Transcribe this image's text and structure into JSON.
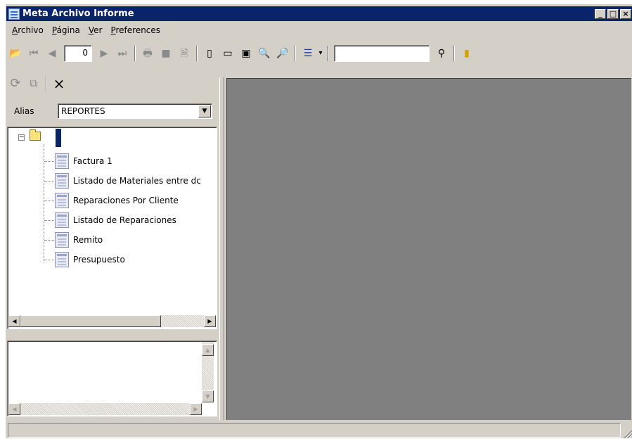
{
  "window": {
    "title": "Meta Archivo Informe",
    "caption_buttons": {
      "minimize": "_",
      "maximize": "□",
      "close": "×"
    }
  },
  "menu": [
    {
      "key": "A",
      "rest": "rchivo"
    },
    {
      "key": "P",
      "rest": "ágina"
    },
    {
      "key": "V",
      "rest": "er"
    },
    {
      "key": "P",
      "rest": "references"
    }
  ],
  "toolbar1": {
    "icons": {
      "open": "📂",
      "first": "⏮",
      "prev": "◀",
      "next": "▶",
      "last": "⏭",
      "print": "🖶",
      "stop": "■",
      "export": "🗎",
      "page_single": "▯",
      "page_width": "▭",
      "page_full": "▣",
      "zoom_out": "🔍",
      "zoom_in": "🔎",
      "layout": "☰",
      "layout_dropdown": "▾",
      "find": "⚲",
      "exit": "▮"
    },
    "page_number": "0",
    "search_value": ""
  },
  "toolbar2": {
    "icons": {
      "refresh": "⟳",
      "merge": "⧉",
      "delete": "×"
    }
  },
  "alias": {
    "label": "Alias",
    "value": "REPORTES",
    "arrow": "▼"
  },
  "tree": {
    "expander": "−",
    "items": [
      {
        "label": "Factura 1"
      },
      {
        "label": "Listado de Materiales entre dc"
      },
      {
        "label": "Reparaciones Por Cliente"
      },
      {
        "label": "Listado de Reparaciones"
      },
      {
        "label": "Remito"
      },
      {
        "label": "Presupuesto"
      }
    ]
  },
  "scroll_arrows": {
    "left": "◀",
    "right": "▶",
    "up": "▲",
    "down": "▼"
  },
  "statusbar": {
    "text": ""
  }
}
